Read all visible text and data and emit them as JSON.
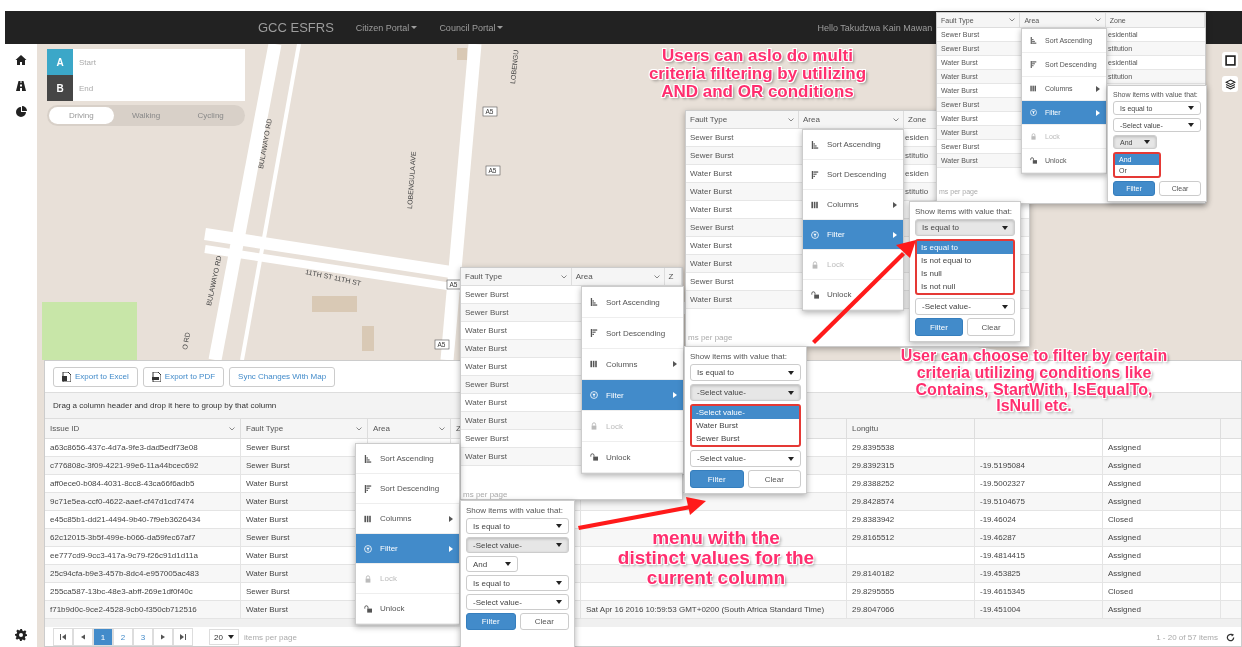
{
  "navbar": {
    "brand": "GCC ESFRS",
    "menus": [
      {
        "label": "Citizen Portal"
      },
      {
        "label": "Council Portal"
      }
    ],
    "greeting": "Hello Takudzwa Kain Mawan"
  },
  "route_panel": {
    "start": {
      "letter": "A",
      "placeholder": "Start"
    },
    "end": {
      "letter": "B",
      "placeholder": "End"
    },
    "modes": [
      {
        "label": "Driving",
        "selected": true
      },
      {
        "label": "Walking",
        "selected": false
      },
      {
        "label": "Cycling",
        "selected": false
      }
    ]
  },
  "map": {
    "labels": [
      {
        "text": "LOBENGU"
      },
      {
        "text": "BULAWAYO RD"
      },
      {
        "text": "LOBENGULA AVE"
      },
      {
        "text": "BULAWAYO RD"
      },
      {
        "text": "11TH ST 11TH ST"
      },
      {
        "text": "O RD"
      }
    ],
    "shields": [
      {
        "text": "A5"
      },
      {
        "text": "A5"
      },
      {
        "text": "A5"
      },
      {
        "text": "A5"
      }
    ]
  },
  "grid": {
    "toolbar": [
      {
        "label": "Export to Excel",
        "kind": "excel"
      },
      {
        "label": "Export to PDF",
        "kind": "pdf"
      },
      {
        "label": "Sync Changes With Map",
        "kind": "plain"
      }
    ],
    "group_hint": "Drag a column header and drop it here to group by that column",
    "columns": [
      "Issue ID",
      "Fault Type",
      "Area",
      "Z",
      null,
      "Longitu",
      null,
      null
    ],
    "rows": [
      [
        "a63c8656-437c-4d7a-9fe3-dad5edf73e08",
        "Sewer Burst",
        null,
        null,
        null,
        "29.8395538",
        null,
        "Assigned"
      ],
      [
        "c776808c-3f09-4221-99e6-11a44bcec692",
        "Sewer Burst",
        null,
        null,
        null,
        "29.8392315",
        "-19.5195084",
        "Assigned"
      ],
      [
        "aff0ece0-b084-4031-8cc8-43ca66f6adb5",
        "Water Burst",
        null,
        null,
        null,
        "29.8388252",
        "-19.5002327",
        "Assigned"
      ],
      [
        "9c71e5ea-ccf0-4622-aaef-cf47d1cd7474",
        "Water Burst",
        null,
        null,
        null,
        "29.8428574",
        "-19.5104675",
        "Assigned"
      ],
      [
        "e45c85b1-dd21-4494-9b40-7f9eb3626434",
        "Water Burst",
        null,
        null,
        null,
        "29.8383942",
        "-19.46024",
        "Closed"
      ],
      [
        "62c12015-3b5f-499e-b066-da59fec67af7",
        "Sewer Burst",
        null,
        null,
        null,
        "29.8165512",
        "-19.46287",
        "Assigned"
      ],
      [
        "ee777cd9-9cc3-417a-9c79-f26c91d1d11a",
        "Water Burst",
        null,
        null,
        null,
        null,
        "-19.4814415",
        "Assigned"
      ],
      [
        "25c94cfa-b9e3-457b-8dc4-e957005ac483",
        "Water Burst",
        null,
        null,
        null,
        "29.8140182",
        "-19.453825",
        "Assigned"
      ],
      [
        "255ca587-13bc-48e3-abff-269e1df0f40c",
        "Sewer Burst",
        null,
        null,
        null,
        "29.8295555",
        "-19.4615345",
        "Closed"
      ],
      [
        "f71b9d0c-9ce2-4528-9cb0-f350cb712516",
        "Water Burst",
        null,
        null,
        "Sat Apr 16 2016 10:59:53 GMT+0200 (South Africa Standard Time)",
        "29.8047066",
        "-19.451004",
        "Assigned"
      ]
    ],
    "pager": {
      "pages": [
        {
          "label": "1",
          "selected": true
        },
        {
          "label": "2",
          "selected": false
        },
        {
          "label": "3",
          "selected": false
        }
      ],
      "page_size": "20",
      "page_size_label": "items per page",
      "summary": "1 - 20 of 57 items"
    },
    "column_menu": [
      {
        "label": "Sort Ascending",
        "kind": "sort-asc",
        "submenu": false,
        "selected": false,
        "disabled": false
      },
      {
        "label": "Sort Descending",
        "kind": "sort-desc",
        "submenu": false,
        "selected": false,
        "disabled": false
      },
      {
        "label": "Columns",
        "kind": "columns",
        "submenu": true,
        "selected": false,
        "disabled": false
      },
      {
        "label": "Filter",
        "kind": "filter",
        "submenu": true,
        "selected": true,
        "disabled": false
      },
      {
        "label": "Lock",
        "kind": "lock",
        "submenu": false,
        "selected": false,
        "disabled": true
      },
      {
        "label": "Unlock",
        "kind": "unlock",
        "submenu": false,
        "selected": false,
        "disabled": false
      }
    ],
    "filter_panel": {
      "prompt": "Show items with value that:",
      "controls": [
        {
          "kind": "select",
          "value": "Is equal to",
          "open": false
        },
        {
          "kind": "select",
          "value": "-Select value-",
          "open": true
        },
        {
          "kind": "select-small",
          "value": "And",
          "open": false
        },
        {
          "kind": "select",
          "value": "Is equal to",
          "open": false
        },
        {
          "kind": "select",
          "value": "-Select value-",
          "open": false
        }
      ],
      "buttons": [
        {
          "label": "Filter",
          "primary": true
        },
        {
          "label": "Clear",
          "primary": false
        }
      ]
    }
  },
  "insets": [
    {
      "columns": [
        "Fault Type",
        "Area",
        "Z"
      ],
      "rows": [
        {
          "fault_type": "Sewer Burst"
        },
        {
          "fault_type": "Sewer Burst"
        },
        {
          "fault_type": "Water Burst"
        },
        {
          "fault_type": "Water Burst"
        },
        {
          "fault_type": "Water Burst"
        },
        {
          "fault_type": "Sewer Burst"
        },
        {
          "fault_type": "Water Burst"
        },
        {
          "fault_type": "Water Burst"
        },
        {
          "fault_type": "Sewer Burst"
        },
        {
          "fault_type": "Water Burst"
        }
      ],
      "footer": "ms per page",
      "menu": [
        {
          "label": "Sort Ascending",
          "kind": "sort-asc",
          "submenu": false,
          "selected": false,
          "disabled": false
        },
        {
          "label": "Sort Descending",
          "kind": "sort-desc",
          "submenu": false,
          "selected": false,
          "disabled": false
        },
        {
          "label": "Columns",
          "kind": "columns",
          "submenu": true,
          "selected": false,
          "disabled": false
        },
        {
          "label": "Filter",
          "kind": "filter",
          "submenu": true,
          "selected": true,
          "disabled": false
        },
        {
          "label": "Lock",
          "kind": "lock",
          "submenu": false,
          "selected": false,
          "disabled": true
        },
        {
          "label": "Unlock",
          "kind": "unlock",
          "submenu": false,
          "selected": false,
          "disabled": false
        }
      ],
      "filter_panel": {
        "prompt": "Show items with value that:",
        "controls": [
          {
            "kind": "select",
            "value": "Is equal to",
            "open": false
          },
          {
            "kind": "select",
            "value": "-Select value-",
            "open": true,
            "highlighted": true,
            "options": [
              {
                "label": "-Select value-",
                "selected": true
              },
              {
                "label": "Water Burst",
                "selected": false
              },
              {
                "label": "Sewer Burst",
                "selected": false
              }
            ]
          },
          {
            "kind": "select",
            "value": "-Select value-",
            "open": false
          }
        ],
        "buttons": [
          {
            "label": "Filter",
            "primary": true
          },
          {
            "label": "Clear",
            "primary": false
          }
        ]
      }
    },
    {
      "columns": [
        "Fault Type",
        "Area",
        "Zone"
      ],
      "rows": [
        {
          "fault_type": "Sewer Burst",
          "zone": "esiden"
        },
        {
          "fault_type": "Sewer Burst",
          "zone": "stitutio"
        },
        {
          "fault_type": "Water Burst",
          "zone": "esiden"
        },
        {
          "fault_type": "Water Burst",
          "zone": "stitutio"
        },
        {
          "fault_type": "Water Burst"
        },
        {
          "fault_type": "Sewer Burst"
        },
        {
          "fault_type": "Water Burst"
        },
        {
          "fault_type": "Water Burst"
        },
        {
          "fault_type": "Sewer Burst"
        },
        {
          "fault_type": "Water Burst"
        }
      ],
      "footer": "ms per page",
      "menu": [
        {
          "label": "Sort Ascending",
          "kind": "sort-asc",
          "submenu": false,
          "selected": false,
          "disabled": false
        },
        {
          "label": "Sort Descending",
          "kind": "sort-desc",
          "submenu": false,
          "selected": false,
          "disabled": false
        },
        {
          "label": "Columns",
          "kind": "columns",
          "submenu": true,
          "selected": false,
          "disabled": false
        },
        {
          "label": "Filter",
          "kind": "filter",
          "submenu": true,
          "selected": true,
          "disabled": false
        },
        {
          "label": "Lock",
          "kind": "lock",
          "submenu": false,
          "selected": false,
          "disabled": true
        },
        {
          "label": "Unlock",
          "kind": "unlock",
          "submenu": false,
          "selected": false,
          "disabled": false
        }
      ],
      "filter_panel": {
        "prompt": "Show items with value that:",
        "controls": [
          {
            "kind": "select",
            "value": "Is equal to",
            "open": true,
            "highlighted": true,
            "options": [
              {
                "label": "Is equal to",
                "selected": true
              },
              {
                "label": "Is not equal to",
                "selected": false
              },
              {
                "label": "Is null",
                "selected": false
              },
              {
                "label": "Is not null",
                "selected": false
              }
            ]
          },
          {
            "kind": "select",
            "value": "-Select value-",
            "open": false
          }
        ],
        "buttons": [
          {
            "label": "Filter",
            "primary": true
          },
          {
            "label": "Clear",
            "primary": false
          }
        ]
      }
    },
    {
      "columns": [
        "Fault Type",
        "Area",
        "Zone"
      ],
      "rows": [
        {
          "fault_type": "Sewer Burst",
          "zone": "esidential"
        },
        {
          "fault_type": "Sewer Burst",
          "zone": "stitution"
        },
        {
          "fault_type": "Water Burst",
          "zone": "esidential"
        },
        {
          "fault_type": "Water Burst",
          "zone": "stitution"
        },
        {
          "fault_type": "Water Burst"
        },
        {
          "fault_type": "Sewer Burst"
        },
        {
          "fault_type": "Water Burst"
        },
        {
          "fault_type": "Water Burst"
        },
        {
          "fault_type": "Sewer Burst"
        },
        {
          "fault_type": "Water Burst"
        }
      ],
      "footer": "ms per page",
      "menu": [
        {
          "label": "Sort Ascending",
          "kind": "sort-asc",
          "submenu": false,
          "selected": false,
          "disabled": false
        },
        {
          "label": "Sort Descending",
          "kind": "sort-desc",
          "submenu": false,
          "selected": false,
          "disabled": false
        },
        {
          "label": "Columns",
          "kind": "columns",
          "submenu": true,
          "selected": false,
          "disabled": false
        },
        {
          "label": "Filter",
          "kind": "filter",
          "submenu": true,
          "selected": true,
          "disabled": false
        },
        {
          "label": "Lock",
          "kind": "lock",
          "submenu": false,
          "selected": false,
          "disabled": true
        },
        {
          "label": "Unlock",
          "kind": "unlock",
          "submenu": false,
          "selected": false,
          "disabled": false
        }
      ],
      "filter_panel": {
        "prompt": "Show items with value that:",
        "controls": [
          {
            "kind": "select",
            "value": "Is equal to",
            "open": false
          },
          {
            "kind": "select",
            "value": "-Select value-",
            "open": false
          },
          {
            "kind": "select-small",
            "value": "And",
            "open": true,
            "highlighted": true,
            "options": [
              {
                "label": "And",
                "selected": true
              },
              {
                "label": "Or",
                "selected": false
              }
            ]
          }
        ],
        "buttons": [
          {
            "label": "Filter",
            "primary": true
          },
          {
            "label": "Clear",
            "primary": false
          }
        ]
      }
    }
  ],
  "annotations": [
    {
      "text": "Users can aslo do multi\ncriteria filtering by utilizing\nAND  and OR conditions"
    },
    {
      "text": "User can choose to filter by certain\ncriteria utilizing conditions like\nContains, StartWith, IsEqualTo,\nIsNull etc."
    },
    {
      "text": "menu with the\ndistinct values for the\ncurrent column"
    }
  ]
}
